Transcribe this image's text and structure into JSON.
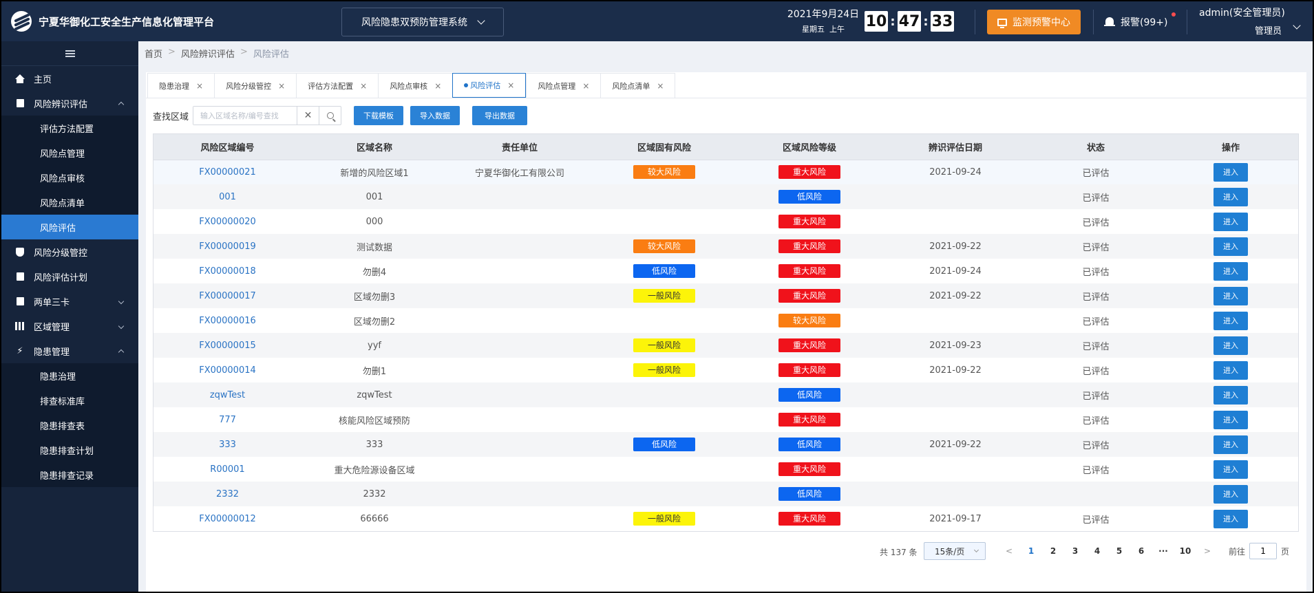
{
  "header": {
    "title": "宁夏华御化工安全生产信息化管理平台",
    "system_select": "风险隐患双预防管理系统",
    "date": "2021年9月24日",
    "weekday": "星期五",
    "ampm": "上午",
    "clock": {
      "hh": "10",
      "mm": "47",
      "ss": "33"
    },
    "monitor_button": "监测预警中心",
    "alarm": "报警(99+)",
    "user_name": "admin(安全管理员)",
    "user_role": "管理员"
  },
  "sidebar": {
    "items": [
      {
        "label": "主页",
        "icon": "home-icon"
      },
      {
        "label": "风险辨识评估",
        "icon": "edit-icon",
        "expanded": true
      },
      {
        "label": "评估方法配置"
      },
      {
        "label": "风险点管理"
      },
      {
        "label": "风险点审核"
      },
      {
        "label": "风险点清单"
      },
      {
        "label": "风险评估",
        "active": true
      },
      {
        "label": "风险分级管控",
        "icon": "shield-icon"
      },
      {
        "label": "风险评估计划",
        "icon": "doc-icon"
      },
      {
        "label": "两单三卡",
        "icon": "clipboard-icon"
      },
      {
        "label": "区域管理",
        "icon": "bars-icon"
      },
      {
        "label": "隐患管理",
        "icon": "bolt-icon",
        "expanded": true
      },
      {
        "label": "隐患治理"
      },
      {
        "label": "排查标准库"
      },
      {
        "label": "隐患排查表"
      },
      {
        "label": "隐患排查计划"
      },
      {
        "label": "隐患排查记录"
      }
    ]
  },
  "breadcrumb": [
    "首页",
    "风险辨识评估",
    "风险评估"
  ],
  "tabs": [
    "隐患治理",
    "风险分级管控",
    "评估方法配置",
    "风险点审核",
    "风险评估",
    "风险点管理",
    "风险点清单"
  ],
  "toolbar": {
    "label": "查找区域",
    "search_placeholder": "输入区域名称/编号查找",
    "download": "下载模板",
    "import": "导入数据",
    "export": "导出数据"
  },
  "table": {
    "columns": [
      "风险区域编号",
      "区域名称",
      "责任单位",
      "区域固有风险",
      "区域风险等级",
      "辨识评估日期",
      "状态",
      "操作"
    ],
    "action_label": "进入",
    "rows": [
      [
        "FX00000021",
        "新增的风险区域1",
        "宁夏华御化工有限公司",
        "较大风险",
        "重大风险",
        "2021-09-24",
        "已评估"
      ],
      [
        "001",
        "001",
        "",
        "",
        "低风险",
        "",
        "已评估"
      ],
      [
        "FX00000020",
        "000",
        "",
        "",
        "重大风险",
        "",
        "已评估"
      ],
      [
        "FX00000019",
        "测试数据",
        "",
        "较大风险",
        "重大风险",
        "2021-09-22",
        "已评估"
      ],
      [
        "FX00000018",
        "勿删4",
        "",
        "低风险",
        "重大风险",
        "2021-09-24",
        "已评估"
      ],
      [
        "FX00000017",
        "区域勿删3",
        "",
        "一般风险",
        "重大风险",
        "2021-09-22",
        "已评估"
      ],
      [
        "FX00000016",
        "区域勿删2",
        "",
        "",
        "较大风险",
        "",
        "已评估"
      ],
      [
        "FX00000015",
        "yyf",
        "",
        "一般风险",
        "重大风险",
        "2021-09-23",
        "已评估"
      ],
      [
        "FX00000014",
        "勿删1",
        "",
        "一般风险",
        "重大风险",
        "2021-09-22",
        "已评估"
      ],
      [
        "zqwTest",
        "zqwTest",
        "",
        "",
        "低风险",
        "",
        "已评估"
      ],
      [
        "777",
        "核能风险区域预防",
        "",
        "",
        "重大风险",
        "",
        "已评估"
      ],
      [
        "333",
        "333",
        "",
        "低风险",
        "低风险",
        "2021-09-22",
        "已评估"
      ],
      [
        "R00001",
        "重大危险源设备区域",
        "",
        "",
        "重大风险",
        "",
        "已评估"
      ],
      [
        "2332",
        "2332",
        "",
        "",
        "低风险",
        "",
        ""
      ],
      [
        "FX00000012",
        "66666",
        "",
        "一般风险",
        "重大风险",
        "2021-09-17",
        "已评估"
      ]
    ]
  },
  "risk_colors": {
    "重大风险": {
      "bg": "#f0121b",
      "fg": "#ffffff"
    },
    "较大风险": {
      "bg": "#fa7d12",
      "fg": "#ffffff"
    },
    "一般风险": {
      "bg": "#fcf409",
      "fg": "#333333"
    },
    "低风险": {
      "bg": "#0c66f0",
      "fg": "#ffffff"
    }
  },
  "pagination": {
    "total": "共 137 条",
    "page_size": "15条/页",
    "pages": [
      "1",
      "2",
      "3",
      "4",
      "5",
      "6",
      "···",
      "10"
    ],
    "current": "1",
    "goto_prefix": "前往",
    "goto_value": "1",
    "goto_suffix": "页"
  }
}
